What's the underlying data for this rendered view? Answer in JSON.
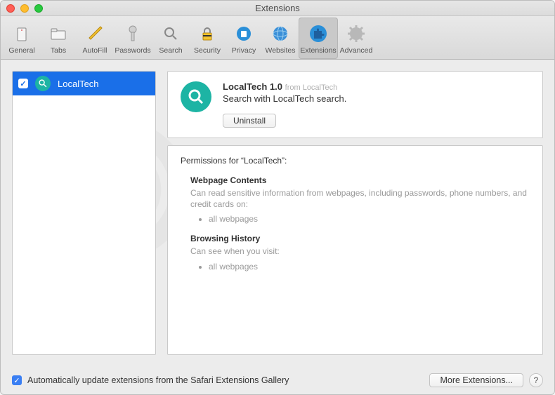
{
  "window": {
    "title": "Extensions"
  },
  "toolbar": {
    "items": [
      {
        "label": "General"
      },
      {
        "label": "Tabs"
      },
      {
        "label": "AutoFill"
      },
      {
        "label": "Passwords"
      },
      {
        "label": "Search"
      },
      {
        "label": "Security"
      },
      {
        "label": "Privacy"
      },
      {
        "label": "Websites"
      },
      {
        "label": "Extensions"
      },
      {
        "label": "Advanced"
      }
    ]
  },
  "sidebar": {
    "items": [
      {
        "name": "LocalTech",
        "checked": true
      }
    ]
  },
  "details": {
    "title": "LocalTech 1.0",
    "from_label": "from LocalTech",
    "description": "Search with LocalTech search.",
    "uninstall_label": "Uninstall"
  },
  "permissions": {
    "heading": "Permissions for “LocalTech”:",
    "blocks": [
      {
        "title": "Webpage Contents",
        "desc": "Can read sensitive information from webpages, including passwords, phone numbers, and credit cards on:",
        "bullets": [
          "all webpages"
        ]
      },
      {
        "title": "Browsing History",
        "desc": "Can see when you visit:",
        "bullets": [
          "all webpages"
        ]
      }
    ]
  },
  "footer": {
    "auto_update_label": "Automatically update extensions from the Safari Extensions Gallery",
    "more_label": "More Extensions...",
    "help_label": "?"
  }
}
